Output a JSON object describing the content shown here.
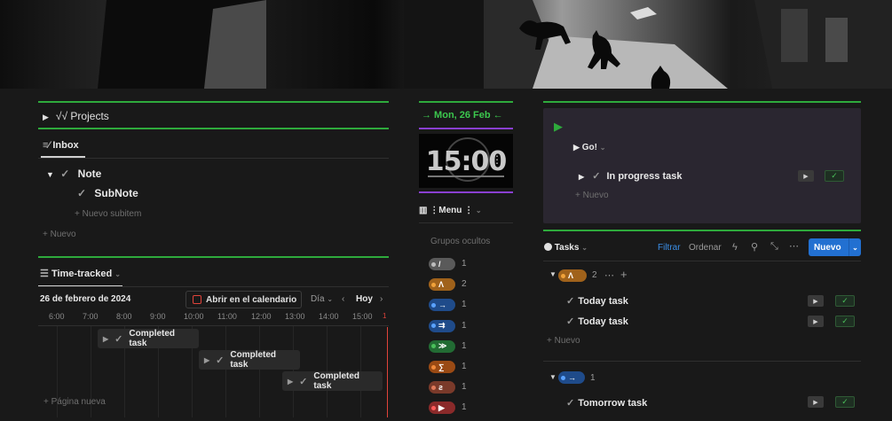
{
  "projects": {
    "toggle": "▶",
    "label": "√√ Projects"
  },
  "inbox": {
    "tab_label": "Inbox",
    "note": "Note",
    "subnote": "SubNote",
    "new_subitem": "Nuevo subitem",
    "new": "Nuevo"
  },
  "time_tracked": {
    "title": "Time-tracked",
    "date": "26 de febrero de 2024",
    "open_calendar": "Abrir en el calendario",
    "view": "Día",
    "today": "Hoy",
    "hours": [
      "6:00",
      "7:00",
      "8:00",
      "9:00",
      "10:00",
      "11:00",
      "12:00",
      "13:00",
      "14:00",
      "15:00"
    ],
    "tasks": [
      "Completed task",
      "Completed task",
      "Completed task"
    ],
    "new_page": "Página nueva"
  },
  "center": {
    "date_label": "→ Mon, 26 Feb ←",
    "clock": "15:00",
    "menu_label": "Menu",
    "hidden_groups": "Grupos ocultos",
    "groups": [
      {
        "symbol": "/",
        "count": "1",
        "color": "#5a5a5a",
        "dot": "#bdbdbd"
      },
      {
        "symbol": "Λ",
        "count": "2",
        "color": "#a0621b",
        "dot": "#f0a23a"
      },
      {
        "symbol": "→",
        "count": "1",
        "color": "#1f4b8a",
        "dot": "#5aa2ff"
      },
      {
        "symbol": "⇉",
        "count": "1",
        "color": "#1f4b8a",
        "dot": "#5aa2ff"
      },
      {
        "symbol": "≫",
        "count": "1",
        "color": "#226b33",
        "dot": "#4ac05a"
      },
      {
        "symbol": "∑",
        "count": "1",
        "color": "#9a4a14",
        "dot": "#f08a3a"
      },
      {
        "symbol": "ƨ",
        "count": "1",
        "color": "#7a3a2a",
        "dot": "#e07a5a"
      },
      {
        "symbol": "▶",
        "count": "1",
        "color": "#8a2a2a",
        "dot": "#ff5a5a"
      }
    ]
  },
  "right": {
    "go_label": "Go!",
    "in_progress": "In progress task",
    "new": "Nuevo",
    "tasks_title": "Tasks",
    "filter": "Filtrar",
    "sort": "Ordenar",
    "new_button": "Nuevo",
    "group1_count": "2",
    "today_tasks": [
      "Today task",
      "Today task"
    ],
    "group1_new": "Nuevo",
    "group2_count": "1",
    "tomorrow_task": "Tomorrow task"
  },
  "colors": {
    "accent_green": "#2eaa3c",
    "accent_purple": "#8a3fd1",
    "accent_blue": "#2270d1",
    "now_line": "#e0433a"
  }
}
